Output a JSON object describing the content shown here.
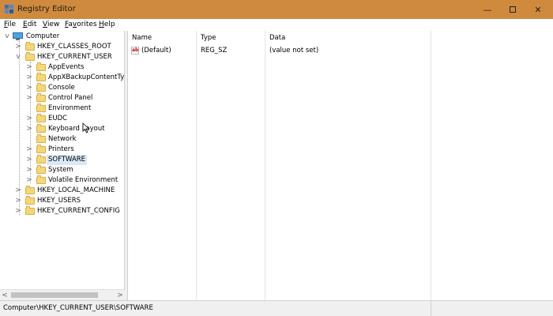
{
  "window": {
    "title": "Registry Editor",
    "controls": {
      "minimize": "—",
      "close": "✕"
    }
  },
  "menu": {
    "items": [
      {
        "label_ul": "F",
        "label_rest": "ile"
      },
      {
        "label_ul": "E",
        "label_rest": "dit"
      },
      {
        "label_ul": "V",
        "label_rest": "iew"
      },
      {
        "label_ul": "F",
        "label_rest": "a",
        "label_ul2": "v",
        "label_rest2": "orites"
      },
      {
        "label_ul": "H",
        "label_rest": "elp"
      }
    ]
  },
  "tree": {
    "root": "Computer",
    "items": [
      {
        "label": "HKEY_CLASSES_ROOT",
        "expander": ">"
      },
      {
        "label": "HKEY_CURRENT_USER",
        "expander": "v"
      },
      {
        "label": "AppEvents",
        "expander": ">"
      },
      {
        "label": "AppXBackupContentTyp",
        "expander": ">"
      },
      {
        "label": "Console",
        "expander": ">"
      },
      {
        "label": "Control Panel",
        "expander": ">"
      },
      {
        "label": "Environment",
        "expander": ""
      },
      {
        "label": "EUDC",
        "expander": ">"
      },
      {
        "label": "Keyboard Layout",
        "expander": ">"
      },
      {
        "label": "Network",
        "expander": ""
      },
      {
        "label": "Printers",
        "expander": ">"
      },
      {
        "label": "SOFTWARE",
        "expander": ">",
        "selected": true
      },
      {
        "label": "System",
        "expander": ">"
      },
      {
        "label": "Volatile Environment",
        "expander": ">"
      },
      {
        "label": "HKEY_LOCAL_MACHINE",
        "expander": ">"
      },
      {
        "label": "HKEY_USERS",
        "expander": ">"
      },
      {
        "label": "HKEY_CURRENT_CONFIG",
        "expander": ">"
      }
    ],
    "scroll_left": "<",
    "scroll_right": ">"
  },
  "list": {
    "columns": [
      "Name",
      "Type",
      "Data"
    ],
    "rows": [
      {
        "icon_text": "ab",
        "name": "(Default)",
        "type": "REG_SZ",
        "data": "(value not set)"
      }
    ]
  },
  "status": {
    "path": "Computer\\HKEY_CURRENT_USER\\SOFTWARE"
  },
  "colors": {
    "titlebar": "#d08a3d",
    "selection": "#d9e8f7",
    "folder": "#f6d67a"
  }
}
